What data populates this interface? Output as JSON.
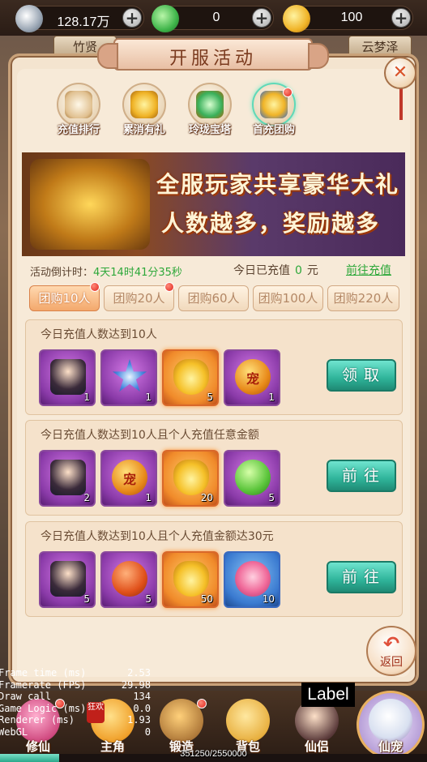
{
  "currency": {
    "silver": "128.17万",
    "jade": "0",
    "gold": "100"
  },
  "side_tabs": {
    "left": "竹贤",
    "right": "云梦泽"
  },
  "panel": {
    "title": "开服活动"
  },
  "activities": [
    {
      "label": "充值排行",
      "icon": "ranking-scroll-icon"
    },
    {
      "label": "累消有礼",
      "icon": "gift-gold-icon"
    },
    {
      "label": "玲珑宝塔",
      "icon": "pagoda-icon"
    },
    {
      "label": "首充团购",
      "icon": "treasure-group-icon",
      "selected": true
    }
  ],
  "banner": {
    "line1": "全服玩家共享豪华大礼",
    "line2": "人数越多，奖励越多"
  },
  "countdown": {
    "label": "活动倒计时：",
    "value": "4天14时41分35秒"
  },
  "today_recharge": {
    "label": "今日已充值",
    "amount": "0",
    "unit": "元",
    "link": "前往充值"
  },
  "group_tabs": [
    "团购10人",
    "团购20人",
    "团购60人",
    "团购100人",
    "团购220人"
  ],
  "tasks": [
    {
      "desc": "今日充值人数达到10人",
      "button": "领取",
      "items": [
        {
          "icon": "character-avatar-icon",
          "count": "1",
          "style": "purple"
        },
        {
          "icon": "blue-crystal-star-icon",
          "count": "1",
          "style": "purple"
        },
        {
          "icon": "gold-ingot-icon",
          "count": "5",
          "style": "orange"
        },
        {
          "icon": "pet-token-icon",
          "count": "1",
          "style": "purple",
          "glyph": "宠"
        }
      ]
    },
    {
      "desc": "今日充值人数达到10人且个人充值任意金额",
      "button": "前往",
      "items": [
        {
          "icon": "character-avatar-icon",
          "count": "2",
          "style": "purple"
        },
        {
          "icon": "pet-token-icon",
          "count": "1",
          "style": "purple",
          "glyph": "宠"
        },
        {
          "icon": "gold-ingot-icon",
          "count": "20",
          "style": "orange"
        },
        {
          "icon": "green-heart-orb-icon",
          "count": "5",
          "style": "purple"
        }
      ]
    },
    {
      "desc": "今日充值人数达到10人且个人充值金额达30元",
      "button": "前往",
      "items": [
        {
          "icon": "character-avatar-icon",
          "count": "5",
          "style": "purple"
        },
        {
          "icon": "sword-orb-icon",
          "count": "5",
          "style": "purple"
        },
        {
          "icon": "gold-ingot-icon",
          "count": "50",
          "style": "orange"
        },
        {
          "icon": "pink-rose-icon",
          "count": "10",
          "style": "blue"
        }
      ]
    }
  ],
  "back_button": "返回",
  "bottom_nav": [
    {
      "label": "修仙"
    },
    {
      "label": "主角"
    },
    {
      "label": "锻造"
    },
    {
      "label": "背包"
    },
    {
      "label": "仙侣"
    },
    {
      "label": "仙宠"
    }
  ],
  "badge": "狂欢",
  "exp": {
    "text": "351250/2550000",
    "fraction": 0.138
  },
  "debug": [
    {
      "k": "Frame time (ms)",
      "v": "2.53"
    },
    {
      "k": "Framerate (FPS)",
      "v": "29.98"
    },
    {
      "k": "Draw call",
      "v": "134"
    },
    {
      "k": "Game Logic (ms)",
      "v": "0.0"
    },
    {
      "k": "Renderer (ms)",
      "v": "1.93"
    },
    {
      "k": "WebGL",
      "v": "0"
    }
  ],
  "overlay_label": "Label",
  "colors": {
    "accent_green": "#2ea83a",
    "button_teal": "#2fb49a",
    "panel_bg": "#f7ead8"
  }
}
